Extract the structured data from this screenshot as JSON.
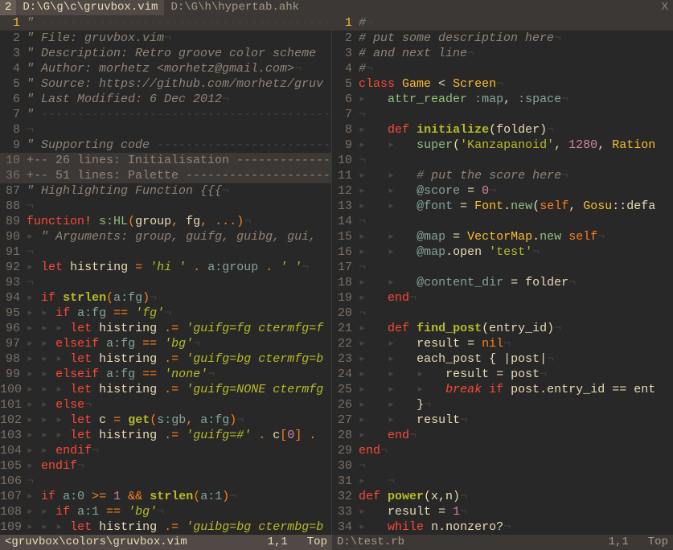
{
  "tabbar": {
    "count": "2",
    "tabs": [
      {
        "label": "D:\\G\\g\\c\\gruvbox.vim",
        "active": true
      },
      {
        "label": "D:\\G\\h\\hypertab.ahk",
        "active": false
      }
    ],
    "close": "X"
  },
  "status": {
    "left": {
      "file": "<gruvbox\\colors\\gruvbox.vim",
      "pos": "1,1",
      "pct": "Top"
    },
    "right": {
      "file": "D:\\test.rb",
      "pos": "1,1",
      "pct": "Top"
    }
  },
  "left_lines": [
    {
      "n": "1",
      "cursor": true,
      "html": "<span class='cm'>\" </span><span class='ws'>-----------------------------------------------------------</span>"
    },
    {
      "n": "2",
      "html": "<span class='cm'>\" File: </span><span class='hdr'>gruvbox.vim</span><span class='ws'>¬</span>"
    },
    {
      "n": "3",
      "html": "<span class='cm'>\" Description: </span><span class='hdr'>Retro groove color scheme </span>"
    },
    {
      "n": "4",
      "html": "<span class='cm'>\" Author: </span><span class='hdr'>morhetz &lt;morhetz@gmail.com&gt;</span><span class='ws'>¬</span>"
    },
    {
      "n": "5",
      "html": "<span class='cm'>\" Source: </span><span class='hdr'>https://github.com/morhetz/gruv</span>"
    },
    {
      "n": "6",
      "html": "<span class='cm'>\" Last Modified: </span><span class='hdr'>6 Dec 2012</span><span class='ws'>¬</span>"
    },
    {
      "n": "7",
      "html": "<span class='cm'>\" </span><span class='ws'>-----------------------------------------------------------</span>"
    },
    {
      "n": "8",
      "html": "<span class='ws'>¬</span>"
    },
    {
      "n": "9",
      "html": "<span class='cm'>\" Supporting code </span><span class='ws'>-------------------------</span>"
    },
    {
      "n": "10",
      "fold": true,
      "html": "<span class='cmn'>+-- 26 lines: Initialisation --------------</span>"
    },
    {
      "n": "36",
      "fold": true,
      "html": "<span class='cmn'>+-- 51 lines: Palette ---------------------</span>"
    },
    {
      "n": "87",
      "html": "<span class='cm'>\" Highlighting Function {{{</span><span class='ws'>¬</span>"
    },
    {
      "n": "88",
      "html": "<span class='ws'>¬</span>"
    },
    {
      "n": "89",
      "html": "<span class='kw'>function</span><span class='or'>!</span> <span class='aq'>s:HL</span><span class='or'>(</span><span class='id'>group</span><span class='or'>,</span> <span class='id'>fg</span><span class='or'>,</span> <span class='or'>...</span><span class='or'>)</span><span class='ws'>¬</span>"
    },
    {
      "n": "90",
      "html": "<span class='ws'>▸ </span><span class='cm'>\" Arguments: group, guifg, guibg, gui, </span>"
    },
    {
      "n": "91",
      "html": "<span class='ws'>¬</span>"
    },
    {
      "n": "92",
      "html": "<span class='ws'>▸ </span><span class='kw'>let</span> <span class='id'>histring</span> <span class='or'>=</span> <span class='str'>'hi '</span> <span class='or'>.</span> <span class='sym'>a:group</span> <span class='or'>.</span> <span class='str'>' '</span><span class='ws'>¬</span>"
    },
    {
      "n": "93",
      "html": "<span class='ws'>¬</span>"
    },
    {
      "n": "94",
      "html": "<span class='ws'>▸ </span><span class='kw'>if</span> <span class='fn'>strlen</span><span class='or'>(</span><span class='sym'>a:fg</span><span class='or'>)</span><span class='ws'>¬</span>"
    },
    {
      "n": "95",
      "html": "<span class='ws'>▸ ▸ </span><span class='kw'>if</span> <span class='sym'>a:fg</span> <span class='or'>==</span> <span class='str'>'fg'</span><span class='ws'>¬</span>"
    },
    {
      "n": "96",
      "html": "<span class='ws'>▸ ▸ ▸ </span><span class='kw'>let</span> <span class='id'>histring</span> <span class='or'>.=</span> <span class='str'>'guifg=fg ctermfg=f</span>"
    },
    {
      "n": "97",
      "html": "<span class='ws'>▸ ▸ </span><span class='kw'>elseif</span> <span class='sym'>a:fg</span> <span class='or'>==</span> <span class='str'>'bg'</span><span class='ws'>¬</span>"
    },
    {
      "n": "98",
      "html": "<span class='ws'>▸ ▸ ▸ </span><span class='kw'>let</span> <span class='id'>histring</span> <span class='or'>.=</span> <span class='str'>'guifg=bg ctermfg=b</span>"
    },
    {
      "n": "99",
      "html": "<span class='ws'>▸ ▸ </span><span class='kw'>elseif</span> <span class='sym'>a:fg</span> <span class='or'>==</span> <span class='str'>'none'</span><span class='ws'>¬</span>"
    },
    {
      "n": "100",
      "html": "<span class='ws'>▸ ▸ ▸ </span><span class='kw'>let</span> <span class='id'>histring</span> <span class='or'>.=</span> <span class='str'>'guifg=NONE ctermfg</span>"
    },
    {
      "n": "101",
      "html": "<span class='ws'>▸ ▸ </span><span class='kw'>else</span><span class='ws'>¬</span>"
    },
    {
      "n": "102",
      "html": "<span class='ws'>▸ ▸ ▸ </span><span class='kw'>let</span> <span class='id'>c</span> <span class='or'>=</span> <span class='fn'>get</span><span class='or'>(</span><span class='sym'>s:gb</span><span class='or'>,</span> <span class='sym'>a:fg</span><span class='or'>)</span><span class='ws'>¬</span>"
    },
    {
      "n": "103",
      "html": "<span class='ws'>▸ ▸ ▸ </span><span class='kw'>let</span> <span class='id'>histring</span> <span class='or'>.=</span> <span class='str'>'guifg=#'</span> <span class='or'>.</span> <span class='id'>c</span><span class='or'>[</span><span class='num'>0</span><span class='or'>]</span> <span class='or'>.</span> "
    },
    {
      "n": "104",
      "html": "<span class='ws'>▸ ▸ </span><span class='kw'>endif</span><span class='ws'>¬</span>"
    },
    {
      "n": "105",
      "html": "<span class='ws'>▸ </span><span class='kw'>endif</span><span class='ws'>¬</span>"
    },
    {
      "n": "106",
      "html": "<span class='ws'>¬</span>"
    },
    {
      "n": "107",
      "html": "<span class='ws'>▸ </span><span class='kw'>if</span> <span class='sym'>a:0</span> <span class='or'>&gt;=</span> <span class='num'>1</span> <span class='or'>&amp;&amp;</span> <span class='fn'>strlen</span><span class='or'>(</span><span class='sym'>a:1</span><span class='or'>)</span><span class='ws'>¬</span>"
    },
    {
      "n": "108",
      "html": "<span class='ws'>▸ ▸ </span><span class='kw'>if</span> <span class='sym'>a:1</span> <span class='or'>==</span> <span class='str'>'bg'</span><span class='ws'>¬</span>"
    },
    {
      "n": "109",
      "html": "<span class='ws'>▸ ▸ ▸ </span><span class='kw'>let</span> <span class='id'>histring</span> <span class='or'>.=</span> <span class='str'>'guibg=bg ctermbg=b</span>"
    }
  ],
  "right_lines": [
    {
      "n": "1",
      "cursor": true,
      "html": "<span class='cm'>#</span><span class='ws'>¬</span>"
    },
    {
      "n": "2",
      "html": "<span class='cm'># put some description here</span><span class='ws'>¬</span>"
    },
    {
      "n": "3",
      "html": "<span class='cm'># and next line</span><span class='ws'>¬</span>"
    },
    {
      "n": "4",
      "html": "<span class='cm'>#</span><span class='ws'>¬</span>"
    },
    {
      "n": "5",
      "html": "<span class='kw'>class</span> <span class='typ'>Game</span> <span class='id'>&lt;</span> <span class='typ'>Screen</span><span class='ws'>¬</span>"
    },
    {
      "n": "6",
      "html": "<span class='ws'>▸   </span><span class='aq'>attr_reader</span> <span class='sym'>:map</span><span class='id'>,</span> <span class='sym'>:space</span><span class='ws'>¬</span>"
    },
    {
      "n": "7",
      "html": "<span class='ws'>¬</span>"
    },
    {
      "n": "8",
      "html": "<span class='ws'>▸   </span><span class='kw'>def</span> <span class='fn'>initialize</span><span class='id'>(folder)</span><span class='ws'>¬</span>"
    },
    {
      "n": "9",
      "html": "<span class='ws'>▸   ▸   </span><span class='aq'>super</span><span class='id'>(</span><span class='strn'>'Kanzapanoid'</span><span class='id'>,</span> <span class='num'>1280</span><span class='id'>,</span> <span class='typ'>Ration</span>"
    },
    {
      "n": "10",
      "html": "<span class='ws'>¬</span>"
    },
    {
      "n": "11",
      "html": "<span class='ws'>▸   ▸   </span><span class='cm'># put the score here</span><span class='ws'>¬</span>"
    },
    {
      "n": "12",
      "html": "<span class='ws'>▸   ▸   </span><span class='sym'>@score</span> <span class='id'>=</span> <span class='num'>0</span><span class='ws'>¬</span>"
    },
    {
      "n": "13",
      "html": "<span class='ws'>▸   ▸   </span><span class='sym'>@font</span> <span class='id'>=</span> <span class='typ'>Font</span><span class='id'>.</span><span class='aq'>new</span><span class='id'>(</span><span class='or'>self</span><span class='id'>,</span> <span class='typ'>Gosu</span><span class='id'>::defa</span>"
    },
    {
      "n": "14",
      "html": "<span class='ws'>¬</span>"
    },
    {
      "n": "15",
      "html": "<span class='ws'>▸   ▸   </span><span class='sym'>@map</span> <span class='id'>=</span> <span class='typ'>VectorMap</span><span class='id'>.</span><span class='aq'>new</span> <span class='or'>self</span><span class='ws'>¬</span>"
    },
    {
      "n": "16",
      "html": "<span class='ws'>▸   ▸   </span><span class='sym'>@map</span><span class='id'>.open</span> <span class='strn'>'test'</span><span class='ws'>¬</span>"
    },
    {
      "n": "17",
      "html": "<span class='ws'>¬</span>"
    },
    {
      "n": "18",
      "html": "<span class='ws'>▸   ▸   </span><span class='sym'>@content_dir</span> <span class='id'>=</span> <span class='id'>folder</span><span class='ws'>¬</span>"
    },
    {
      "n": "19",
      "html": "<span class='ws'>▸   </span><span class='kw'>end</span><span class='ws'>¬</span>"
    },
    {
      "n": "20",
      "html": "<span class='ws'>¬</span>"
    },
    {
      "n": "21",
      "html": "<span class='ws'>▸   </span><span class='kw'>def</span> <span class='fn'>find_post</span><span class='id'>(entry_id)</span><span class='ws'>¬</span>"
    },
    {
      "n": "22",
      "html": "<span class='ws'>▸   ▸   </span><span class='id'>result</span> <span class='id'>=</span> <span class='or'>nil</span><span class='ws'>¬</span>"
    },
    {
      "n": "23",
      "html": "<span class='ws'>▸   ▸   </span><span class='id'>each_post {</span> <span class='id'>|</span><span class='id'>post</span><span class='id'>|</span><span class='ws'>¬</span>"
    },
    {
      "n": "24",
      "html": "<span class='ws'>▸   ▸   ▸   </span><span class='id'>result</span> <span class='id'>=</span> <span class='id'>post</span><span class='ws'>¬</span>"
    },
    {
      "n": "25",
      "html": "<span class='ws'>▸   ▸   ▸   </span><span class='kwi'>break</span> <span class='kw'>if</span> <span class='id'>post.entry_id</span> <span class='id'>==</span> <span class='id'>ent</span>"
    },
    {
      "n": "26",
      "html": "<span class='ws'>▸   ▸   </span><span class='id'>}</span><span class='ws'>¬</span>"
    },
    {
      "n": "27",
      "html": "<span class='ws'>▸   ▸   </span><span class='id'>result</span><span class='ws'>¬</span>"
    },
    {
      "n": "28",
      "html": "<span class='ws'>▸   </span><span class='kw'>end</span><span class='ws'>¬</span>"
    },
    {
      "n": "29",
      "html": "<span class='kw'>end</span><span class='ws'>¬</span>"
    },
    {
      "n": "30",
      "html": "<span class='ws'>¬</span>"
    },
    {
      "n": "31",
      "html": "<span class='ws'>▸   </span><span class='ws'>¬</span>"
    },
    {
      "n": "32",
      "html": "<span class='kw'>def</span> <span class='fn'>power</span><span class='id'>(x,n)</span><span class='ws'>¬</span>"
    },
    {
      "n": "33",
      "html": "<span class='ws'>▸   </span><span class='id'>result</span> <span class='id'>=</span> <span class='num'>1</span><span class='ws'>¬</span>"
    },
    {
      "n": "34",
      "html": "<span class='ws'>▸   </span><span class='kw'>while</span> <span class='id'>n.nonzero?</span><span class='ws'>¬</span>"
    }
  ]
}
